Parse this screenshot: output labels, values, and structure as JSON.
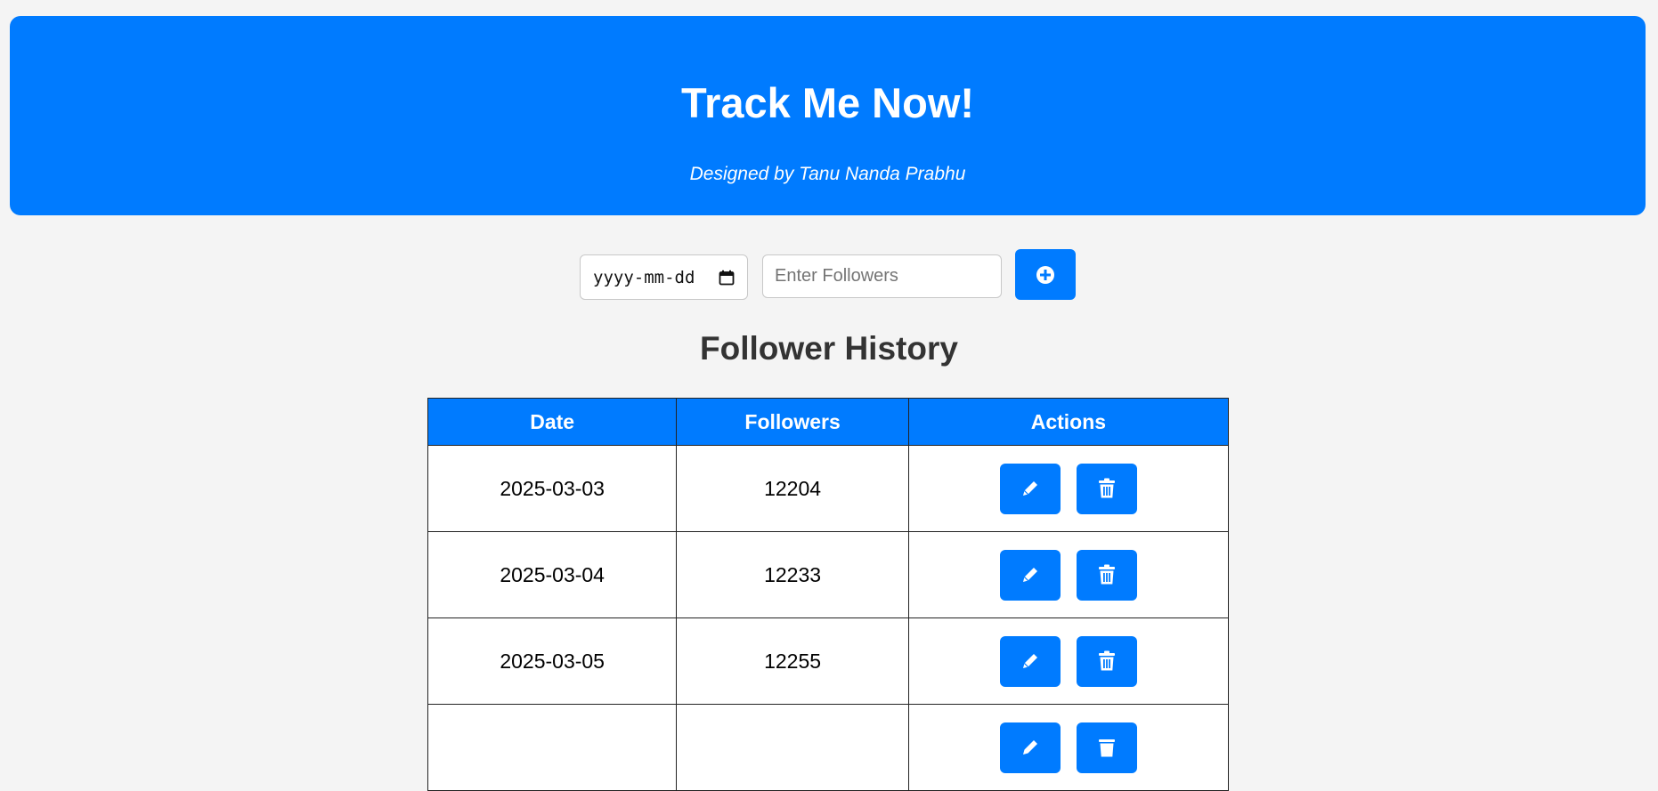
{
  "header": {
    "title": "Track Me Now!",
    "subtitle": "Designed by Tanu Nanda Prabhu",
    "background_color": "#007bff"
  },
  "form": {
    "date_placeholder": "yyyy-mm-dd",
    "date_icon": "calendar-icon",
    "followers_placeholder": "Enter Followers",
    "add_button_icon": "plus-circle-icon"
  },
  "history": {
    "title": "Follower History",
    "columns": [
      "Date",
      "Followers",
      "Actions"
    ],
    "rows": [
      {
        "date": "2025-03-03",
        "followers": "12204"
      },
      {
        "date": "2025-03-04",
        "followers": "12233"
      },
      {
        "date": "2025-03-05",
        "followers": "12255"
      },
      {
        "date": "",
        "followers": ""
      }
    ],
    "row_actions": [
      {
        "icon": "pencil-icon",
        "name": "edit"
      },
      {
        "icon": "trash-icon",
        "name": "delete"
      }
    ]
  },
  "colors": {
    "accent": "#007bff",
    "page_background": "#f4f4f4",
    "heading_text": "#333333"
  }
}
